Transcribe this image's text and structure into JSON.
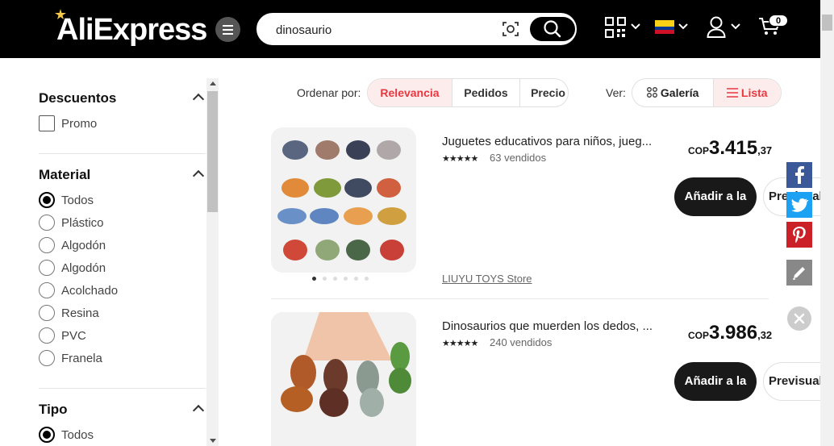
{
  "header": {
    "logo_text": "AliExpress",
    "search": {
      "value": "dinosaurio",
      "placeholder": ""
    },
    "cart_count": "0",
    "colors": {
      "bg": "#000000",
      "accent": "#e8373f"
    },
    "icons": [
      "menu-icon",
      "camera-search-icon",
      "search-icon",
      "qr-code-icon",
      "chevron-down-icon",
      "colombia-flag-icon",
      "user-icon",
      "cart-icon"
    ]
  },
  "sidebar": {
    "sections": [
      {
        "title": "Descuentos",
        "type": "checkbox",
        "options": [
          "Promo"
        ]
      },
      {
        "title": "Material",
        "type": "radio",
        "selected": "Todos",
        "options": [
          "Todos",
          "Plástico",
          "Algodón",
          "Algodón",
          "Acolchado",
          "Resina",
          "PVC",
          "Franela"
        ]
      },
      {
        "title": "Tipo",
        "type": "radio",
        "selected": "Todos",
        "options": [
          "Todos"
        ]
      }
    ]
  },
  "sort": {
    "label": "Ordenar por:",
    "options": [
      "Relevancia",
      "Pedidos",
      "Precio"
    ],
    "active": "Relevancia"
  },
  "view": {
    "label": "Ver:",
    "options": [
      "Galería",
      "Lista"
    ],
    "active": "Lista"
  },
  "products": [
    {
      "title": "Juguetes educativos para niños, jueg...",
      "rating_stars": "★★★★★",
      "sold": "63 vendidos",
      "price_currency": "COP",
      "price_int": "3.415",
      "price_dec": ",37",
      "add_label": "Añadir a la",
      "preview_label": "Previsual",
      "store": "LIUYU TOYS Store"
    },
    {
      "title": "Dinosaurios que muerden los dedos, ...",
      "rating_stars": "★★★★★",
      "sold": "240 vendidos",
      "price_currency": "COP",
      "price_int": "3.986",
      "price_dec": ",32",
      "add_label": "Añadir a la",
      "preview_label": "Previsual"
    }
  ],
  "share_bar": {
    "items": [
      "facebook-icon",
      "twitter-icon",
      "pinterest-icon",
      "edit-icon",
      "close-icon"
    ],
    "colors": {
      "facebook": "#3b5998",
      "twitter": "#1da1f2",
      "pinterest": "#cb2027",
      "edit": "#888888"
    }
  }
}
